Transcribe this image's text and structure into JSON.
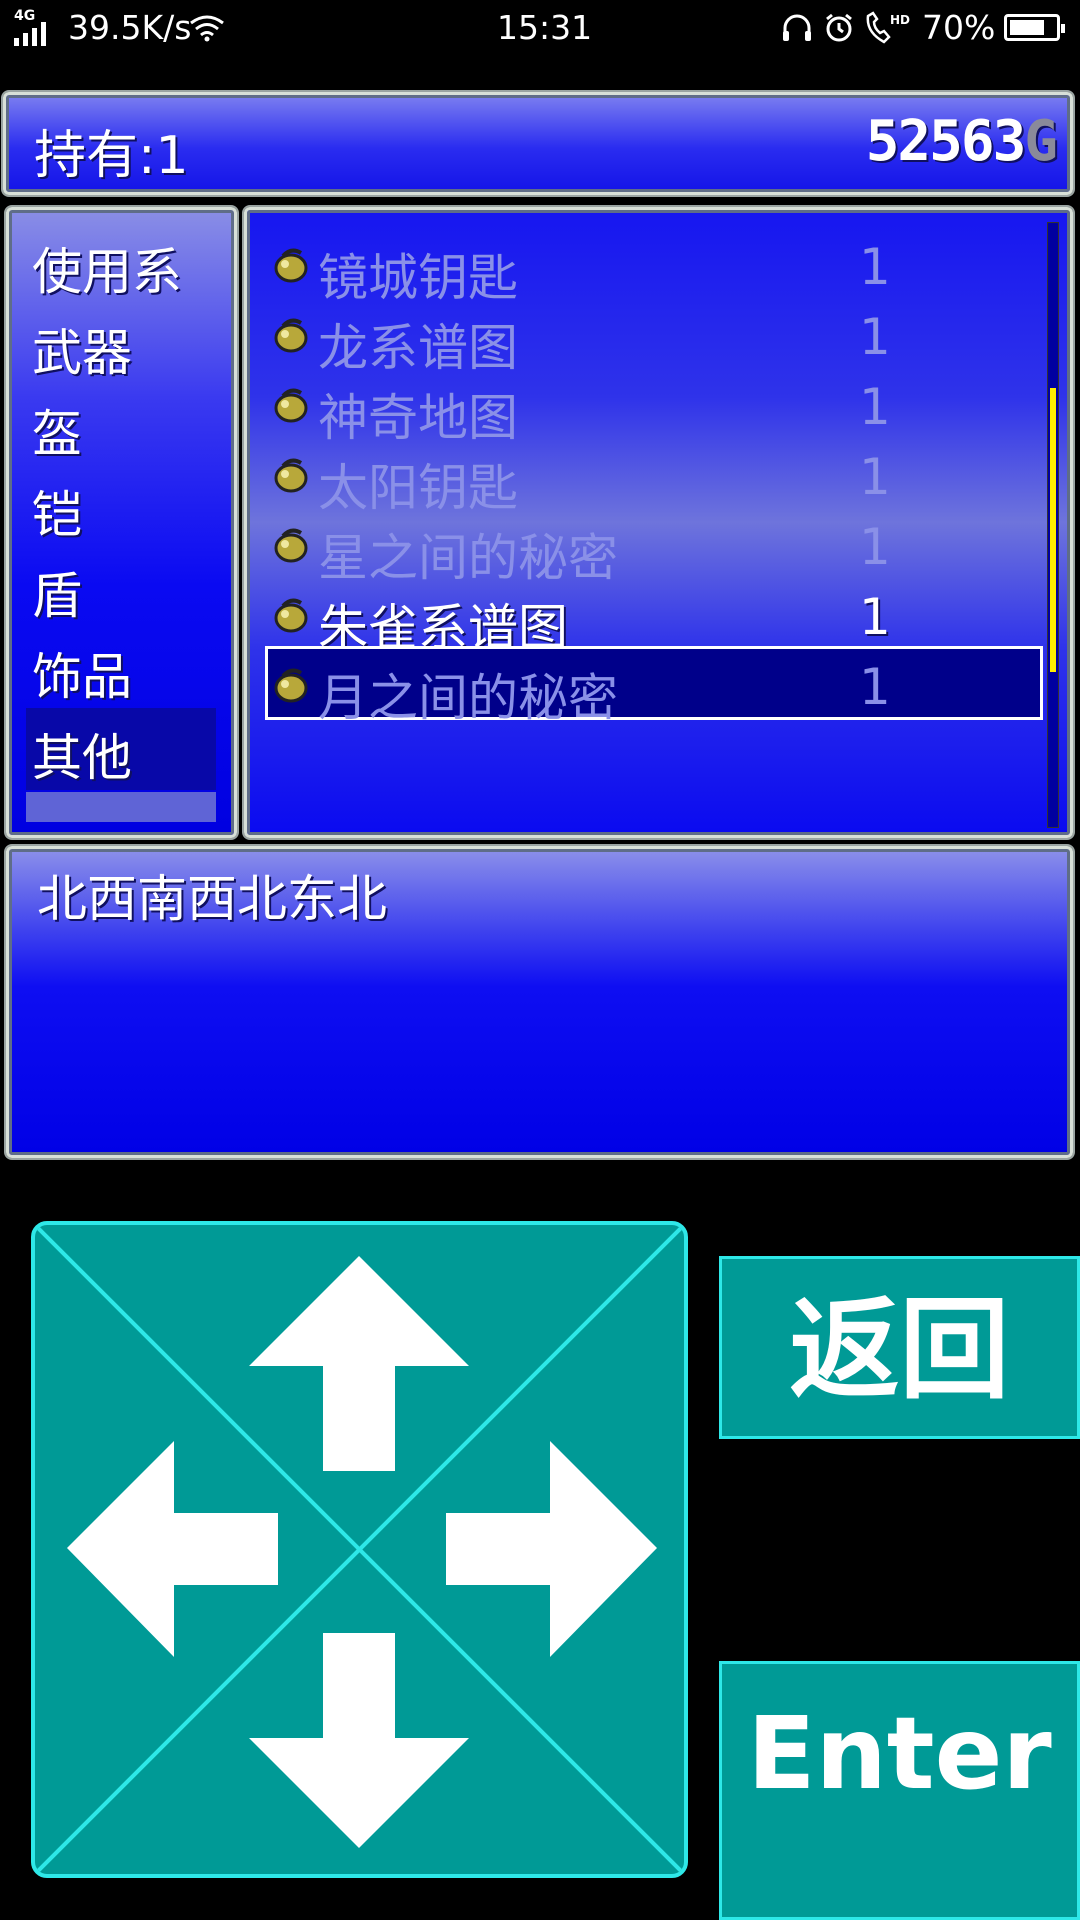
{
  "status_bar": {
    "network_type": "4G",
    "net_speed": "39.5K/s",
    "time": "15:31",
    "battery": "70%",
    "icons": [
      "signal-icon",
      "wifi-icon",
      "headset-icon",
      "alarm-icon",
      "hd-call-icon",
      "battery-icon"
    ]
  },
  "header": {
    "holding_label": "持有:1",
    "gold_amount": "52563",
    "gold_unit": "G"
  },
  "categories": {
    "items": [
      "使用系",
      "武器",
      "盔",
      "铠",
      "盾",
      "饰品",
      "其他"
    ],
    "selected": "其他"
  },
  "items": [
    {
      "name": "镜城钥匙",
      "qty": "1",
      "state": "dim"
    },
    {
      "name": "龙系谱图",
      "qty": "1",
      "state": "dim"
    },
    {
      "name": "神奇地图",
      "qty": "1",
      "state": "dim"
    },
    {
      "name": "太阳钥匙",
      "qty": "1",
      "state": "dim"
    },
    {
      "name": "星之间的秘密",
      "qty": "1",
      "state": "dim"
    },
    {
      "name": "朱雀系谱图",
      "qty": "1",
      "state": "bright"
    },
    {
      "name": "月之间的秘密",
      "qty": "1",
      "state": "selected"
    }
  ],
  "description": "北西南西北东北",
  "controls": {
    "dpad_icons": [
      "arrow-up-icon",
      "arrow-left-icon",
      "arrow-right-icon",
      "arrow-down-icon"
    ],
    "back_label": "返回",
    "enter_label": "Enter"
  },
  "colors": {
    "window_blue": "#0000e6",
    "button_teal": "#009a96",
    "button_border": "#2ee8e8",
    "scroll_thumb": "#ffee00"
  }
}
